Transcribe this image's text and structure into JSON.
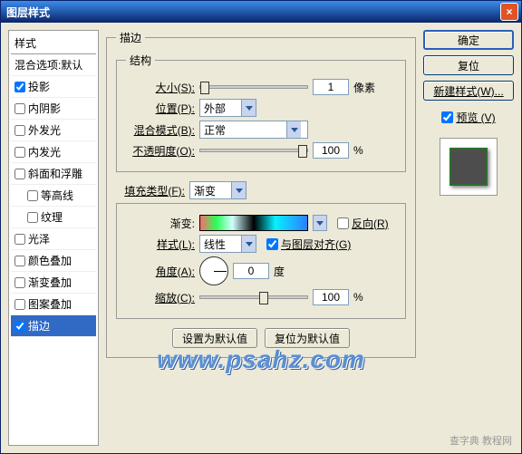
{
  "title": "图层样式",
  "close": "×",
  "sidebar": {
    "header": "样式",
    "blend_opts": "混合选项:默认",
    "items": [
      {
        "label": "投影",
        "checked": true,
        "selected": false,
        "indent": false
      },
      {
        "label": "内阴影",
        "checked": false,
        "selected": false,
        "indent": false
      },
      {
        "label": "外发光",
        "checked": false,
        "selected": false,
        "indent": false
      },
      {
        "label": "内发光",
        "checked": false,
        "selected": false,
        "indent": false
      },
      {
        "label": "斜面和浮雕",
        "checked": false,
        "selected": false,
        "indent": false
      },
      {
        "label": "等高线",
        "checked": false,
        "selected": false,
        "indent": true
      },
      {
        "label": "纹理",
        "checked": false,
        "selected": false,
        "indent": true
      },
      {
        "label": "光泽",
        "checked": false,
        "selected": false,
        "indent": false
      },
      {
        "label": "颜色叠加",
        "checked": false,
        "selected": false,
        "indent": false
      },
      {
        "label": "渐变叠加",
        "checked": false,
        "selected": false,
        "indent": false
      },
      {
        "label": "图案叠加",
        "checked": false,
        "selected": false,
        "indent": false
      },
      {
        "label": "描边",
        "checked": true,
        "selected": true,
        "indent": false
      }
    ]
  },
  "main": {
    "group_title": "描边",
    "structure": {
      "legend": "结构",
      "size_label": "大小(S):",
      "size_value": "1",
      "size_unit": "像素",
      "position_label": "位置(P):",
      "position_value": "外部",
      "blend_label": "混合模式(B):",
      "blend_value": "正常",
      "opacity_label": "不透明度(O):",
      "opacity_value": "100",
      "opacity_unit": "%"
    },
    "fill": {
      "filltype_label": "填充类型(F):",
      "filltype_value": "渐变",
      "gradient_label": "渐变:",
      "reverse_label": "反向(R)",
      "style_label": "样式(L):",
      "style_value": "线性",
      "align_label": "与图层对齐(G)",
      "angle_label": "角度(A):",
      "angle_value": "0",
      "angle_unit": "度",
      "scale_label": "缩放(C):",
      "scale_value": "100",
      "scale_unit": "%"
    },
    "set_default": "设置为默认值",
    "reset_default": "复位为默认值"
  },
  "right": {
    "ok": "确定",
    "reset": "复位",
    "new_style": "新建样式(W)...",
    "preview": "预览 (V)"
  },
  "watermark": "www.psahz.com",
  "footer": "查字典 教程网"
}
